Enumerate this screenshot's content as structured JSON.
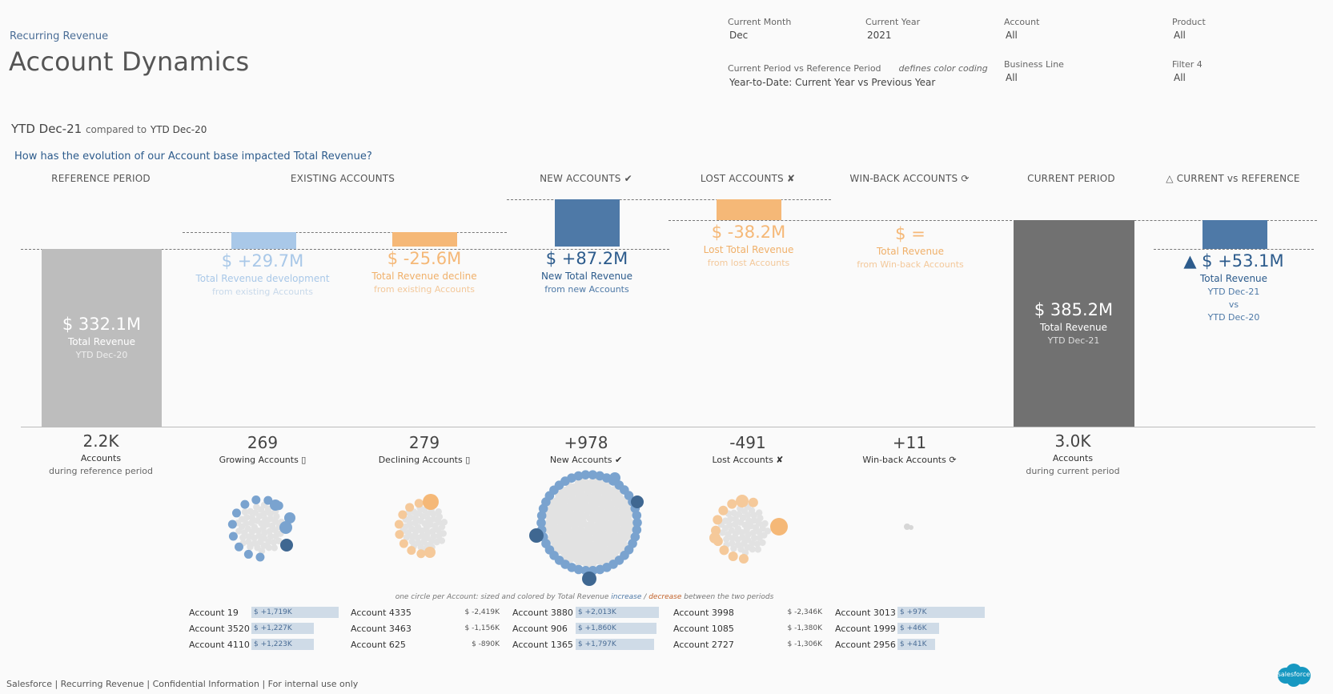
{
  "header": {
    "crumb": "Recurring Revenue",
    "title": "Account Dynamics"
  },
  "filters": [
    {
      "label": "Current Month",
      "value": "Dec"
    },
    {
      "label": "Current Year",
      "value": "2021"
    },
    {
      "label": "Account",
      "value": "All"
    },
    {
      "label": "Product",
      "value": "All"
    },
    {
      "label": "Current Period vs Reference Period",
      "note": "defines color coding",
      "value": "Year-to-Date: Current Year vs Previous Year"
    },
    {
      "label": "Business Line",
      "value": "All"
    },
    {
      "label": "Filter 4",
      "value": "All"
    }
  ],
  "period": {
    "current": "YTD Dec-21",
    "compared_text": "compared to",
    "reference": "YTD Dec-20"
  },
  "question": "How has the evolution of our Account base impacted Total Revenue?",
  "columns": [
    "REFERENCE PERIOD",
    "EXISTING ACCOUNTS",
    "NEW ACCOUNTS ✔",
    "LOST ACCOUNTS ✘",
    "WIN-BACK ACCOUNTS ⟳",
    "CURRENT PERIOD",
    "△ CURRENT vs REFERENCE"
  ],
  "waterfall": {
    "reference": {
      "value": "$ 332.1M",
      "label": "Total Revenue",
      "sub": "YTD Dec-20"
    },
    "growth": {
      "value": "$ +29.7M",
      "label": "Total Revenue development",
      "sub": "from existing Accounts"
    },
    "decline": {
      "value": "$ -25.6M",
      "label": "Total Revenue decline",
      "sub": "from existing Accounts"
    },
    "new": {
      "value": "$ +87.2M",
      "label": "New Total Revenue",
      "sub": "from new Accounts"
    },
    "lost": {
      "value": "$ -38.2M",
      "label": "Lost Total Revenue",
      "sub": "from lost Accounts"
    },
    "winback": {
      "value": "$ =",
      "label": "Total Revenue",
      "sub": "from Win-back Accounts"
    },
    "current": {
      "value": "$ 385.2M",
      "label": "Total Revenue",
      "sub": "YTD Dec-21"
    },
    "delta": {
      "value": "▲ $ +53.1M",
      "label": "Total Revenue",
      "sub1": "YTD Dec-21",
      "sub2": "vs",
      "sub3": "YTD Dec-20"
    }
  },
  "counts": [
    {
      "value": "2.2K",
      "label": "Accounts",
      "sub": "during reference period"
    },
    {
      "value": "269",
      "label": "Growing Accounts ▯"
    },
    {
      "value": "279",
      "label": "Declining Accounts ▯"
    },
    {
      "value": "+978",
      "label": "New Accounts ✔"
    },
    {
      "value": "-491",
      "label": "Lost Accounts ✘"
    },
    {
      "value": "+11",
      "label": "Win-back Accounts ⟳"
    },
    {
      "value": "3.0K",
      "label": "Accounts",
      "sub": "during current period"
    }
  ],
  "circle_note": {
    "prefix": "one circle per Account: sized and colored by Total Revenue",
    "increase": "increase",
    "sep": "/",
    "decrease": "decrease",
    "suffix": "between the two periods"
  },
  "accounts": {
    "growing": [
      {
        "name": "Account 19",
        "value": "$ +1,719K",
        "frac": 1.0
      },
      {
        "name": "Account 3520",
        "value": "$ +1,227K",
        "frac": 0.71
      },
      {
        "name": "Account 4110",
        "value": "$ +1,223K",
        "frac": 0.71
      }
    ],
    "declining": [
      {
        "name": "Account 4335",
        "value": "$ -2,419K"
      },
      {
        "name": "Account 3463",
        "value": "$ -1,156K"
      },
      {
        "name": "Account 625",
        "value": "$ -890K"
      }
    ],
    "new": [
      {
        "name": "Account 3880",
        "value": "$ +2,013K",
        "frac": 1.0
      },
      {
        "name": "Account 906",
        "value": "$ +1,860K",
        "frac": 0.92
      },
      {
        "name": "Account 1365",
        "value": "$ +1,797K",
        "frac": 0.89
      }
    ],
    "lost": [
      {
        "name": "Account 3998",
        "value": "$ -2,346K"
      },
      {
        "name": "Account 1085",
        "value": "$ -1,380K"
      },
      {
        "name": "Account 2727",
        "value": "$ -1,306K"
      }
    ],
    "winback": [
      {
        "name": "Account 3013",
        "value": "$ +97K",
        "frac": 1.0
      },
      {
        "name": "Account 1999",
        "value": "$ +46K",
        "frac": 0.47
      },
      {
        "name": "Account 2956",
        "value": "$ +41K",
        "frac": 0.42
      }
    ]
  },
  "footer": "Salesforce | Recurring Revenue | Confidential Information | For internal use only",
  "logo": "salesforce",
  "colors": {
    "increase": "#4e79a7",
    "increase_light": "#a9c8e8",
    "decrease": "#f5b877",
    "reference": "#bdbdbd",
    "current": "#717171",
    "title": "#2c5b8c"
  }
}
